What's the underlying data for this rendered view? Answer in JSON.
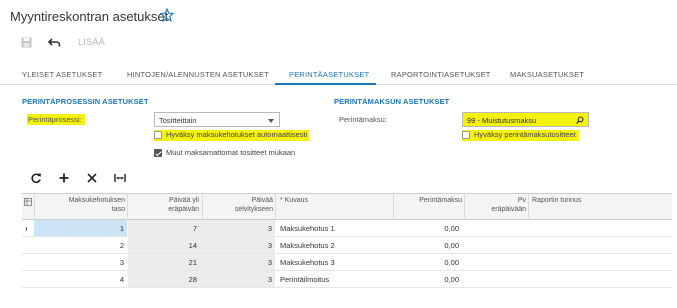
{
  "header": {
    "title": "Myyntireskontran asetukset",
    "favorite_icon": "star-outline-icon"
  },
  "toolbar": {
    "save_icon": "save-icon",
    "undo_icon": "undo-icon",
    "add_label": "LISÄÄ"
  },
  "tabs": [
    {
      "label": "YLEISET ASETUKSET",
      "active": false
    },
    {
      "label": "HINTOJEN/ALENNUSTEN ASETUKSET",
      "active": false
    },
    {
      "label": "PERINTÄASETUKSET",
      "active": true
    },
    {
      "label": "RAPORTOINTIASETUKSET",
      "active": false
    },
    {
      "label": "MAKSUASETUKSET",
      "active": false
    }
  ],
  "collection_process": {
    "section_title": "PERINTÄPROSESSIN ASETUKSET",
    "process_label": "Perintäprosessi:",
    "process_value": "Tositteittain",
    "auto_approve_label": "Hyväksy maksukehotukset automaattisesti",
    "auto_approve_checked": false,
    "include_other_label": "Muut maksamattomat tositteet mukaan",
    "include_other_checked": true
  },
  "collection_fee": {
    "section_title": "PERINTÄMAKSUN ASETUKSET",
    "fee_label": "Perintämaksu:",
    "fee_value": "99 - Muistutusmaksu",
    "approve_fee_docs_label": "Hyväksy perintämaksutositteet",
    "approve_fee_docs_checked": false
  },
  "grid_toolbar": {
    "icons": [
      "refresh-icon",
      "add-row-icon",
      "delete-row-icon",
      "fit-columns-icon"
    ]
  },
  "grid": {
    "columns": {
      "level_line1": "Maksukehotuksen",
      "level_line2": "taso",
      "days_overdue_line1": "Päivää yli",
      "days_overdue_line2": "eräpäivän",
      "days_to_settle_line1": "Päivää",
      "days_to_settle_line2": "selvitykseen",
      "description": "* Kuvaus",
      "fee": "Perintämaksu",
      "due_date_line1": "Pv",
      "due_date_line2": "eräpäivään",
      "report_id": "Raportin tunnus"
    },
    "rows": [
      {
        "level": "1",
        "days_overdue": "7",
        "days_to_settle": "3",
        "description": "Maksukehotus 1",
        "fee": "0,00",
        "selected": true
      },
      {
        "level": "2",
        "days_overdue": "14",
        "days_to_settle": "3",
        "description": "Maksukehotus 2",
        "fee": "0,00",
        "selected": false
      },
      {
        "level": "3",
        "days_overdue": "21",
        "days_to_settle": "3",
        "description": "Maksukehotus 3",
        "fee": "0,00",
        "selected": false
      },
      {
        "level": "4",
        "days_overdue": "28",
        "days_to_settle": "3",
        "description": "Perintäilmoitus",
        "fee": "0,00",
        "selected": false
      }
    ]
  },
  "colors": {
    "accent": "#1a75c0",
    "highlight": "#f4f10c",
    "selected_row": "#cde3f6"
  }
}
